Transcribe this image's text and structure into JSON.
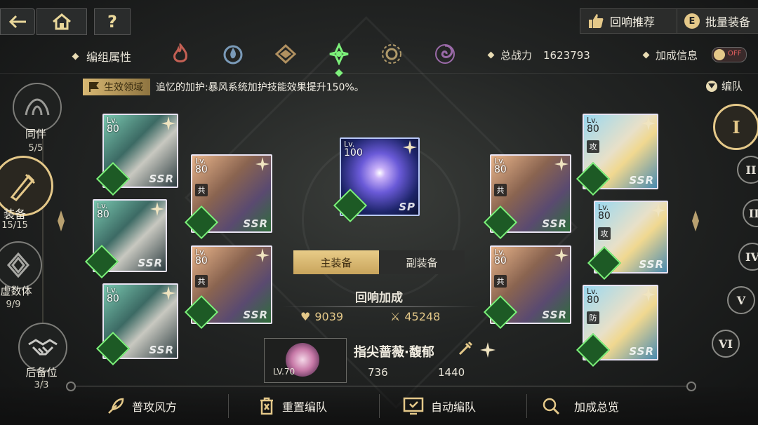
{
  "top": {
    "recommend_label": "回响推荐",
    "batch_equip_label": "批量装备",
    "help_label": "?"
  },
  "attr": {
    "label": "编组属性",
    "power_label": "总战力",
    "power_value": "1623793",
    "bonus_label": "加成信息",
    "toggle_state": "OFF"
  },
  "effect": {
    "tag": "生效领域",
    "text": "追忆的加护:暴风系统加护技能效果提升150%。",
    "formation_label": "编队"
  },
  "nav": [
    {
      "label": "同伴",
      "count": "5/5"
    },
    {
      "label": "装备",
      "count": "15/15"
    },
    {
      "label": "虚数体",
      "count": "9/9"
    },
    {
      "label": "后备位",
      "count": "3/3"
    }
  ],
  "cards": {
    "lv_prefix": "Lv.",
    "rarity": "SSR",
    "col1_lv": "80",
    "col2_lv": "80",
    "center_lv": "100",
    "center_rarity": "SP",
    "col4_lv": "80",
    "col5_lv": "80",
    "role_gong": "共",
    "role_attack": "攻",
    "role_defense": "防"
  },
  "center": {
    "main_tab": "主装备",
    "sub_tab": "副装备",
    "echo_title": "回响加成",
    "hp_value": "9039",
    "atk_value": "45248"
  },
  "echo_item": {
    "level": "LV.70",
    "name": "指尖蔷薇·馥郁",
    "stat1": "736",
    "stat2": "1440"
  },
  "roman": [
    "I",
    "II",
    "III",
    "IV",
    "V",
    "VI"
  ],
  "bottom": {
    "normal_attack": "普攻风方",
    "reset": "重置编队",
    "auto": "自动编队",
    "overview": "加成总览"
  },
  "colors": {
    "accent_gold": "#e4c889",
    "active_wind": "#7cf07a"
  }
}
